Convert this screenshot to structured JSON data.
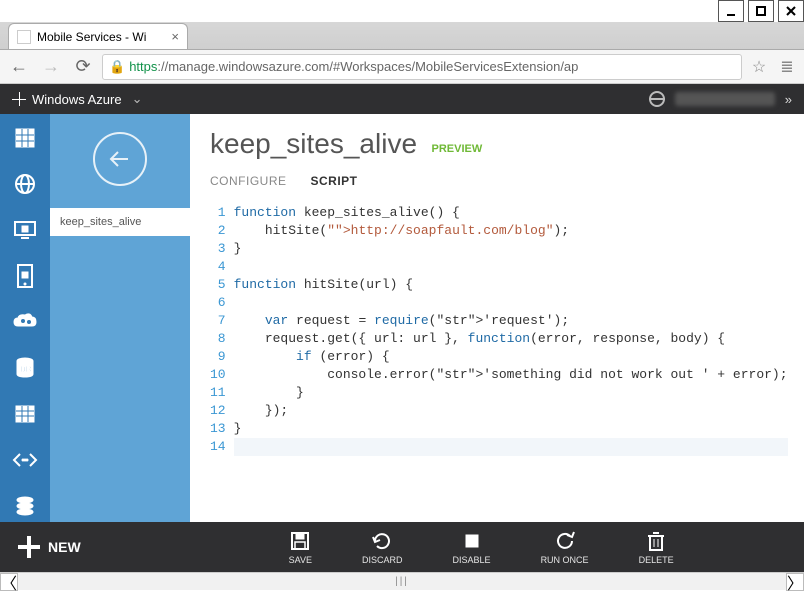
{
  "window": {
    "title": "Mobile Services - Wi"
  },
  "browser": {
    "url_scheme": "https",
    "url_rest": "://manage.windowsazure.com/#Workspaces/MobileServicesExtension/ap"
  },
  "azure_header": {
    "brand": "Windows Azure"
  },
  "sidebar": {
    "items": [
      {
        "icon": "grid-icon"
      },
      {
        "icon": "globe-icon"
      },
      {
        "icon": "monitor-icon"
      },
      {
        "icon": "mobile-icon"
      },
      {
        "icon": "cloud-gear-icon"
      },
      {
        "icon": "db-icon"
      },
      {
        "icon": "table-icon"
      },
      {
        "icon": "code-icon"
      },
      {
        "icon": "stack-icon"
      }
    ]
  },
  "sub_sidebar": {
    "item_label": "keep_sites_alive"
  },
  "page": {
    "title": "keep_sites_alive",
    "badge": "PREVIEW",
    "tabs": [
      {
        "label": "CONFIGURE",
        "active": false
      },
      {
        "label": "SCRIPT",
        "active": true
      }
    ]
  },
  "code": {
    "lines": [
      "function keep_sites_alive() {",
      "    hitSite(\"http://soapfault.com/blog\");",
      "}",
      "",
      "function hitSite(url) {",
      "",
      "    var request = require('request');",
      "    request.get({ url: url }, function(error, response, body) {",
      "        if (error) {",
      "            console.error('something did not work out ' + error);",
      "        }",
      "    });",
      "}",
      ""
    ]
  },
  "bottombar": {
    "new_label": "NEW",
    "actions": [
      {
        "label": "SAVE",
        "icon": "save-icon"
      },
      {
        "label": "DISCARD",
        "icon": "discard-icon"
      },
      {
        "label": "DISABLE",
        "icon": "disable-icon"
      },
      {
        "label": "RUN ONCE",
        "icon": "run-icon"
      },
      {
        "label": "DELETE",
        "icon": "delete-icon"
      }
    ]
  }
}
